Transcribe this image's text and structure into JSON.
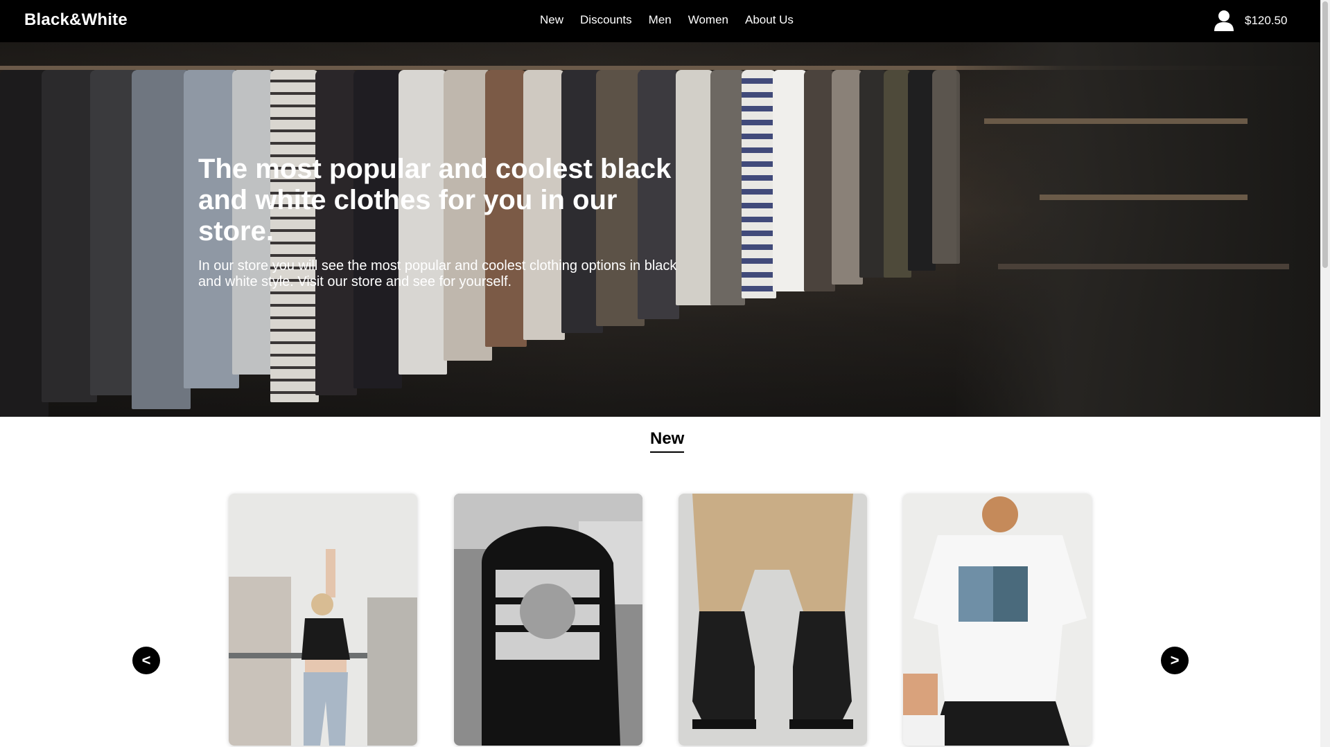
{
  "header": {
    "logo": "Black&White",
    "nav": [
      "New",
      "Discounts",
      "Men",
      "Women",
      "About Us"
    ],
    "cart_total": "$120.50",
    "icons": {
      "account": "user-icon"
    }
  },
  "hero": {
    "title": "The most popular and coolest black and white clothes for you in our store.",
    "subtitle": "In our store you will see the most popular and coolest clothing options in black and white style. Visit our store and see for yourself."
  },
  "section": {
    "title": "New",
    "prev_label": "<",
    "next_label": ">",
    "products": [
      {
        "image": "woman in black t-shirt and ripped jeans"
      },
      {
        "image": "black hoodie with statue print"
      },
      {
        "image": "black chunky lace-up boots"
      },
      {
        "image": "white oversized t-shirt with palm print"
      }
    ]
  },
  "colors": {
    "header_bg": "#000000",
    "accent": "#000000",
    "text_light": "#ffffff"
  }
}
